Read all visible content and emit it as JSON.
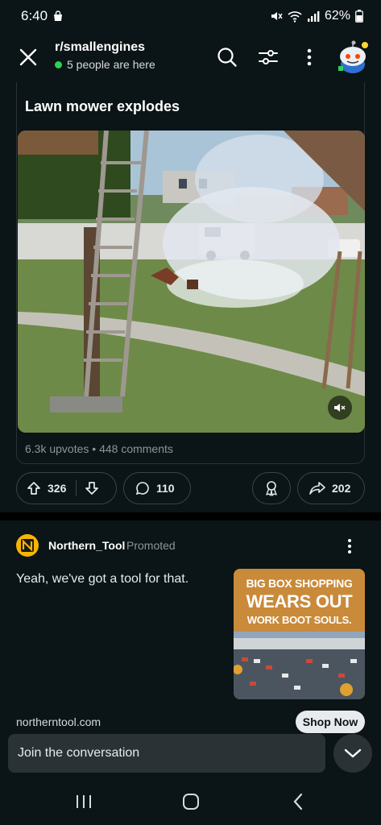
{
  "status_bar": {
    "time": "6:40",
    "battery": "62%"
  },
  "header": {
    "subreddit": "r/smallengines",
    "presence": "5 people are here"
  },
  "post": {
    "title": "Lawn mower explodes",
    "upvotes_label": "6.3k upvotes",
    "comments_label": "448 comments",
    "vote_count": "326",
    "comment_count": "110",
    "share_count": "202"
  },
  "ad": {
    "advertiser": "Northern_Tool",
    "promoted_label": "Promoted",
    "body": "Yeah, we've got a tool for that.",
    "image_line1": "BIG BOX SHOPPING",
    "image_line2": "WEARS OUT",
    "image_line3": "WORK BOOT SOULS.",
    "domain": "northerntool.com",
    "cta": "Shop Now"
  },
  "composer": {
    "placeholder": "Join the conversation"
  },
  "colors": {
    "background": "#0b1416",
    "accent_green": "#2bd152",
    "brand_yellow": "#f7b500"
  },
  "icons": [
    "close-icon",
    "search-icon",
    "filter-icon",
    "more-icon",
    "upvote-icon",
    "downvote-icon",
    "comment-icon",
    "award-icon",
    "share-icon",
    "mute-icon",
    "chevron-down-icon"
  ]
}
